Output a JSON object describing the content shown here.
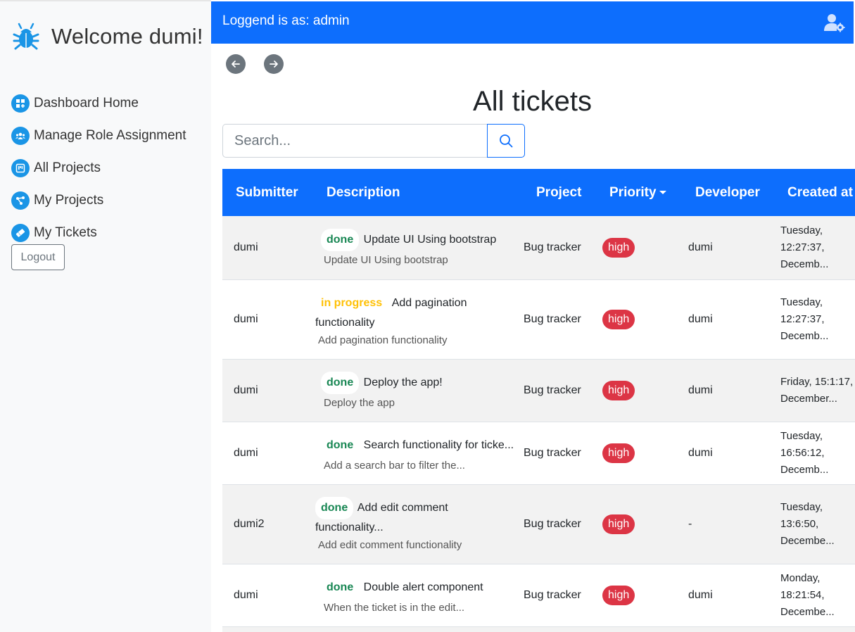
{
  "sidebar": {
    "welcome": "Welcome dumi!",
    "items": [
      {
        "label": "Dashboard Home"
      },
      {
        "label": "Manage Role Assignment"
      },
      {
        "label": "All Projects"
      },
      {
        "label": "My Projects"
      },
      {
        "label": "My Tickets"
      }
    ],
    "logout_label": "Logout"
  },
  "topbar": {
    "logged_text": "Loggend is as: admin"
  },
  "main": {
    "title": "All tickets",
    "search_placeholder": "Search...",
    "table": {
      "headers": {
        "submitter": "Submitter",
        "description": "Description",
        "project": "Project",
        "priority": "Priority",
        "developer": "Developer",
        "created": "Created at"
      },
      "rows": [
        {
          "submitter": "dumi",
          "status": "done",
          "title": "Update UI Using bootstrap",
          "desc": "Update UI Using bootstrap",
          "project": "Bug tracker",
          "priority": "high",
          "developer": "dumi",
          "created1": "Tuesday,",
          "created2": "12:27:37,",
          "created3": "Decemb..."
        },
        {
          "submitter": "dumi",
          "status": "in progress",
          "title": "Add pagination functionality",
          "desc": "Add pagination functionality",
          "project": "Bug tracker",
          "priority": "high",
          "developer": "dumi",
          "created1": "Tuesday,",
          "created2": "12:27:37,",
          "created3": "Decemb..."
        },
        {
          "submitter": "dumi",
          "status": "done",
          "title": "Deploy the app!",
          "desc": "Deploy the app",
          "project": "Bug tracker",
          "priority": "high",
          "developer": "dumi",
          "created1": "Friday, 15:1:17,",
          "created2": "December...",
          "created3": ""
        },
        {
          "submitter": "dumi",
          "status": "done",
          "title": "Search functionality for ticke...",
          "desc": "Add a search bar to filter the...",
          "project": "Bug tracker",
          "priority": "high",
          "developer": "dumi",
          "created1": "Tuesday,",
          "created2": "16:56:12,",
          "created3": "Decemb..."
        },
        {
          "submitter": "dumi2",
          "status": "done",
          "title": "Add edit comment functionality...",
          "desc": "Add edit comment functionality",
          "project": "Bug tracker",
          "priority": "high",
          "developer": "-",
          "created1": "Tuesday,",
          "created2": "13:6:50,",
          "created3": "Decembe..."
        },
        {
          "submitter": "dumi",
          "status": "done",
          "title": "Double alert component",
          "desc": "When the ticket is in the edit...",
          "project": "Bug tracker",
          "priority": "high",
          "developer": "dumi",
          "created1": "Monday,",
          "created2": "18:21:54,",
          "created3": "Decembe..."
        }
      ]
    }
  },
  "colors": {
    "primary": "#0d6efd",
    "nav_icon": "#1a95e6",
    "danger": "#dc3545",
    "success": "#198754",
    "warning": "#ffc107",
    "secondary": "#6c757d"
  },
  "icons": {
    "brand": "bug-icon",
    "nav": [
      "dashboard-icon",
      "users-icon",
      "kanban-icon",
      "share-nodes-icon",
      "ticket-icon"
    ],
    "topbar": "user-gear-icon",
    "search": "search-icon",
    "back": "arrow-left-icon",
    "forward": "arrow-right-icon"
  }
}
